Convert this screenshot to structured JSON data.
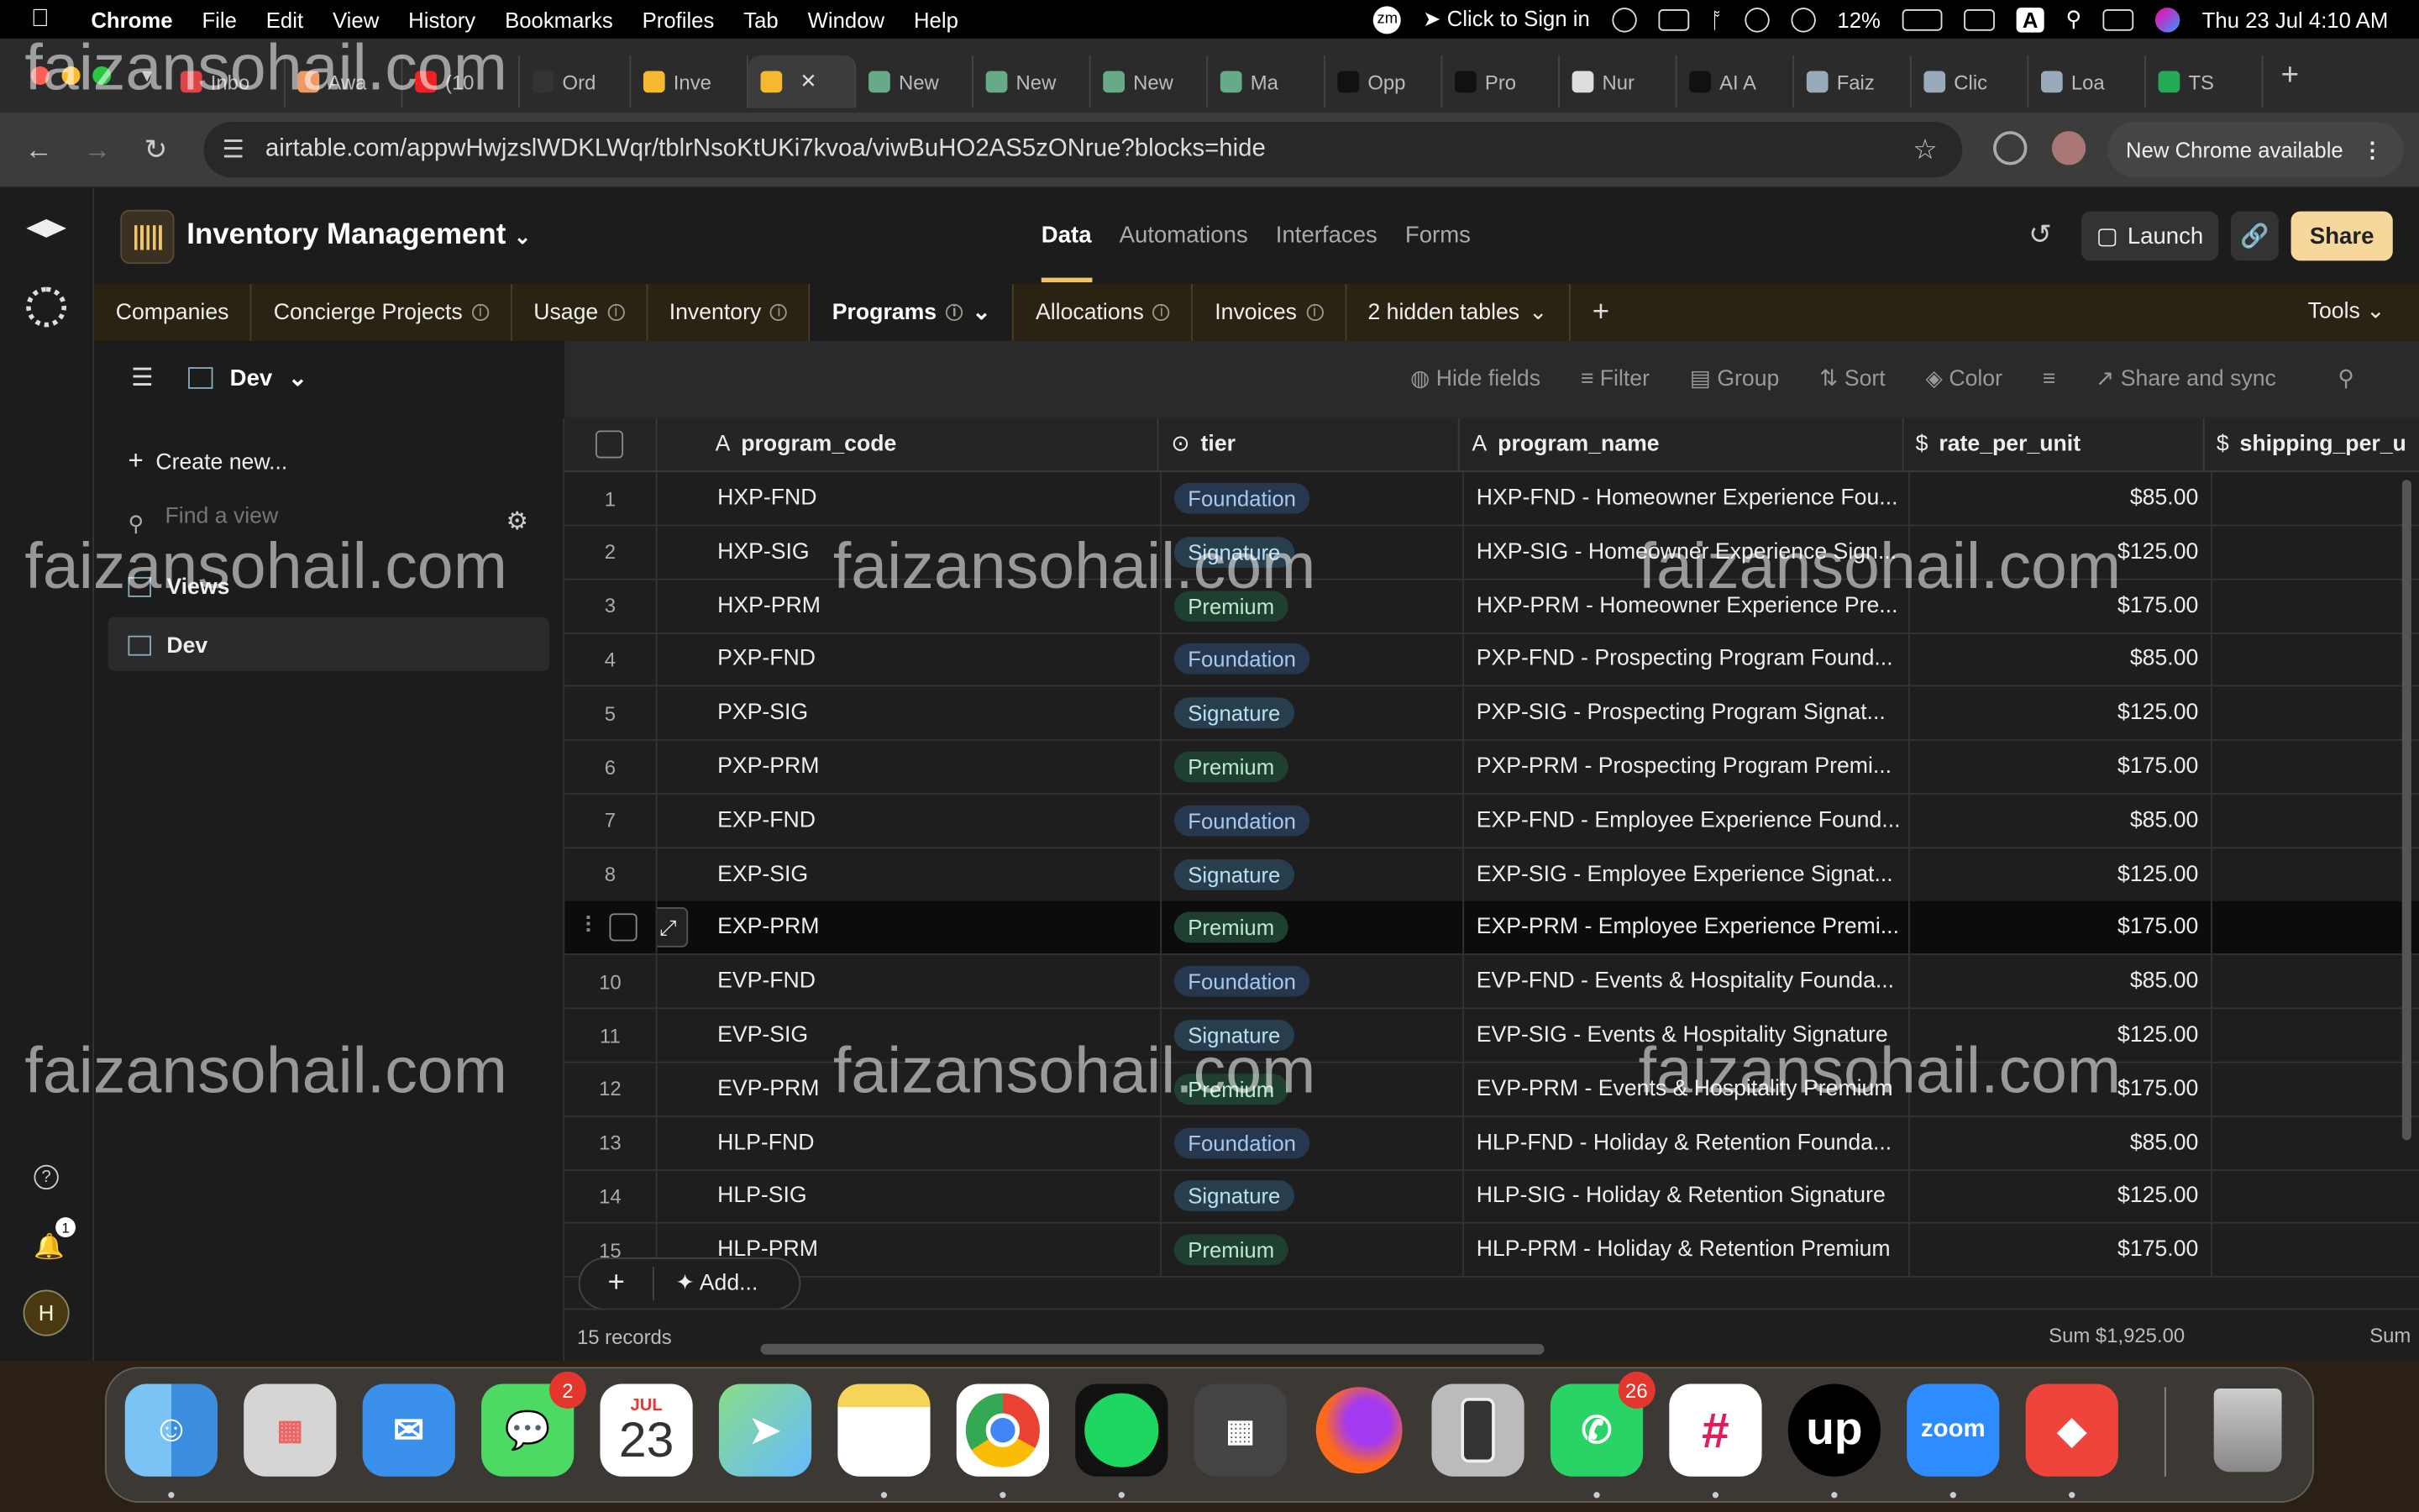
{
  "menubar": {
    "app": "Chrome",
    "items": [
      "File",
      "Edit",
      "View",
      "History",
      "Bookmarks",
      "Profiles",
      "Tab",
      "Window",
      "Help"
    ],
    "sign_in": "Click to Sign in",
    "battery": "12%",
    "input": "A",
    "datetime": "Thu 23 Jul  4:10 AM",
    "zm": "zm"
  },
  "tabs": [
    {
      "label": "Inbo",
      "color": "#d44"
    },
    {
      "label": "Awa",
      "color": "#e96"
    },
    {
      "label": "(10",
      "color": "#e22"
    },
    {
      "label": "Ord",
      "color": "#333"
    },
    {
      "label": "Inve",
      "color": "#f5b82e"
    },
    {
      "label": "",
      "color": "#f5b82e",
      "active": true
    },
    {
      "label": "New",
      "color": "#6a8"
    },
    {
      "label": "New",
      "color": "#6a8"
    },
    {
      "label": "New",
      "color": "#6a8"
    },
    {
      "label": "Ma",
      "color": "#6a8"
    },
    {
      "label": "Opp",
      "color": "#111"
    },
    {
      "label": "Pro",
      "color": "#111"
    },
    {
      "label": "Nur",
      "color": "#ddd"
    },
    {
      "label": "AI A",
      "color": "#111"
    },
    {
      "label": "Faiz",
      "color": "#9ab"
    },
    {
      "label": "Clic",
      "color": "#9ab"
    },
    {
      "label": "Loa",
      "color": "#9ab"
    },
    {
      "label": "TS",
      "color": "#2a5"
    }
  ],
  "address": {
    "url": "airtable.com/appwHwjzslWDKLWqr/tblrNsoKtUKi7kvoa/viwBuHO2AS5zONrue?blocks=hide",
    "new_chrome": "New Chrome available"
  },
  "base": {
    "name": "Inventory Management",
    "nav": [
      "Data",
      "Automations",
      "Interfaces",
      "Forms"
    ],
    "active_nav": "Data",
    "launch": "Launch",
    "share": "Share"
  },
  "tables": [
    {
      "label": "Companies",
      "info": false
    },
    {
      "label": "Concierge Projects",
      "info": true
    },
    {
      "label": "Usage",
      "info": true
    },
    {
      "label": "Inventory",
      "info": true
    },
    {
      "label": "Programs",
      "info": true,
      "active": true
    },
    {
      "label": "Allocations",
      "info": true
    },
    {
      "label": "Invoices",
      "info": true
    },
    {
      "label": "2 hidden tables",
      "info": false,
      "dropdown": true
    }
  ],
  "tools": "Tools",
  "view": {
    "name": "Dev"
  },
  "sidebar": {
    "create": "Create new...",
    "find_placeholder": "Find a view",
    "items": [
      "Views",
      "Dev"
    ]
  },
  "toolbar": [
    "Hide fields",
    "Filter",
    "Group",
    "Sort",
    "Color",
    "Share and sync"
  ],
  "columns": [
    "program_code",
    "tier",
    "program_name",
    "rate_per_unit",
    "shipping_per_u"
  ],
  "rows": [
    {
      "n": "1",
      "code": "HXP-FND",
      "tier": "Foundation",
      "name": "HXP-FND - Homeowner Experience Fou...",
      "rate": "$85.00"
    },
    {
      "n": "2",
      "code": "HXP-SIG",
      "tier": "Signature",
      "name": "HXP-SIG - Homeowner Experience Sign...",
      "rate": "$125.00"
    },
    {
      "n": "3",
      "code": "HXP-PRM",
      "tier": "Premium",
      "name": "HXP-PRM - Homeowner Experience Pre...",
      "rate": "$175.00"
    },
    {
      "n": "4",
      "code": "PXP-FND",
      "tier": "Foundation",
      "name": "PXP-FND - Prospecting Program Found...",
      "rate": "$85.00"
    },
    {
      "n": "5",
      "code": "PXP-SIG",
      "tier": "Signature",
      "name": "PXP-SIG - Prospecting Program Signat...",
      "rate": "$125.00"
    },
    {
      "n": "6",
      "code": "PXP-PRM",
      "tier": "Premium",
      "name": "PXP-PRM - Prospecting Program Premi...",
      "rate": "$175.00"
    },
    {
      "n": "7",
      "code": "EXP-FND",
      "tier": "Foundation",
      "name": "EXP-FND - Employee Experience Found...",
      "rate": "$85.00"
    },
    {
      "n": "8",
      "code": "EXP-SIG",
      "tier": "Signature",
      "name": "EXP-SIG - Employee Experience Signat...",
      "rate": "$125.00"
    },
    {
      "n": "",
      "code": "EXP-PRM",
      "tier": "Premium",
      "name": "EXP-PRM - Employee Experience Premi...",
      "rate": "$175.00",
      "hover": true
    },
    {
      "n": "10",
      "code": "EVP-FND",
      "tier": "Foundation",
      "name": "EVP-FND - Events & Hospitality Founda...",
      "rate": "$85.00"
    },
    {
      "n": "11",
      "code": "EVP-SIG",
      "tier": "Signature",
      "name": "EVP-SIG - Events & Hospitality Signature",
      "rate": "$125.00"
    },
    {
      "n": "12",
      "code": "EVP-PRM",
      "tier": "Premium",
      "name": "EVP-PRM - Events & Hospitality Premium",
      "rate": "$175.00"
    },
    {
      "n": "13",
      "code": "HLP-FND",
      "tier": "Foundation",
      "name": "HLP-FND - Holiday & Retention Founda...",
      "rate": "$85.00"
    },
    {
      "n": "14",
      "code": "HLP-SIG",
      "tier": "Signature",
      "name": "HLP-SIG - Holiday & Retention Signature",
      "rate": "$125.00"
    },
    {
      "n": "15",
      "code": "HLP-PRM",
      "tier": "Premium",
      "name": "HLP-PRM - Holiday & Retention Premium",
      "rate": "$175.00"
    }
  ],
  "footer": {
    "add": "Add...",
    "records": "15 records",
    "sum": "Sum $1,925.00",
    "sum2": "Sum"
  },
  "watermark": "faizansohail.com",
  "dock": {
    "calendar_month": "JUL",
    "calendar_day": "23",
    "messages_badge": "2",
    "whatsapp_badge": "26",
    "upwork": "up",
    "zoom": "zoom"
  },
  "rail": {
    "notif": "1",
    "avatar": "H"
  }
}
